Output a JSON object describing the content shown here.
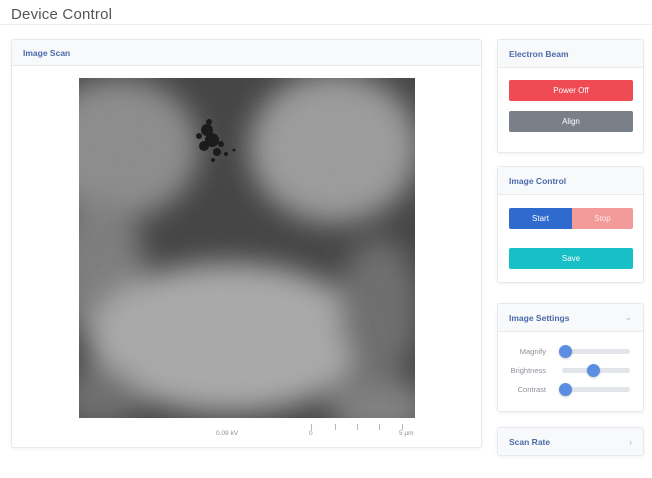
{
  "page": {
    "title": "Device Control"
  },
  "scan": {
    "header": "Image Scan",
    "scale": {
      "value": "0.09 kV",
      "start": "0",
      "end": "5 μm"
    }
  },
  "beam": {
    "header": "Electron Beam",
    "power_label": "Power Off",
    "align_label": "Align",
    "power_color": "#f04a55",
    "align_color": "#7a8088"
  },
  "control": {
    "header": "Image Control",
    "start_label": "Start",
    "stop_label": "Stop",
    "save_label": "Save",
    "start_color": "#2f6bcf",
    "stop_color": "#f39a9a",
    "save_color": "#17bfc6"
  },
  "settings": {
    "header": "Image Settings",
    "collapse_icon": "chevron-down-icon",
    "sliders": [
      {
        "label": "Magnify",
        "value": 0.05
      },
      {
        "label": "Brightness",
        "value": 0.45
      },
      {
        "label": "Contrast",
        "value": 0.05
      }
    ]
  },
  "rate": {
    "header": "Scan Rate",
    "expand_icon": "chevron-right-icon"
  }
}
